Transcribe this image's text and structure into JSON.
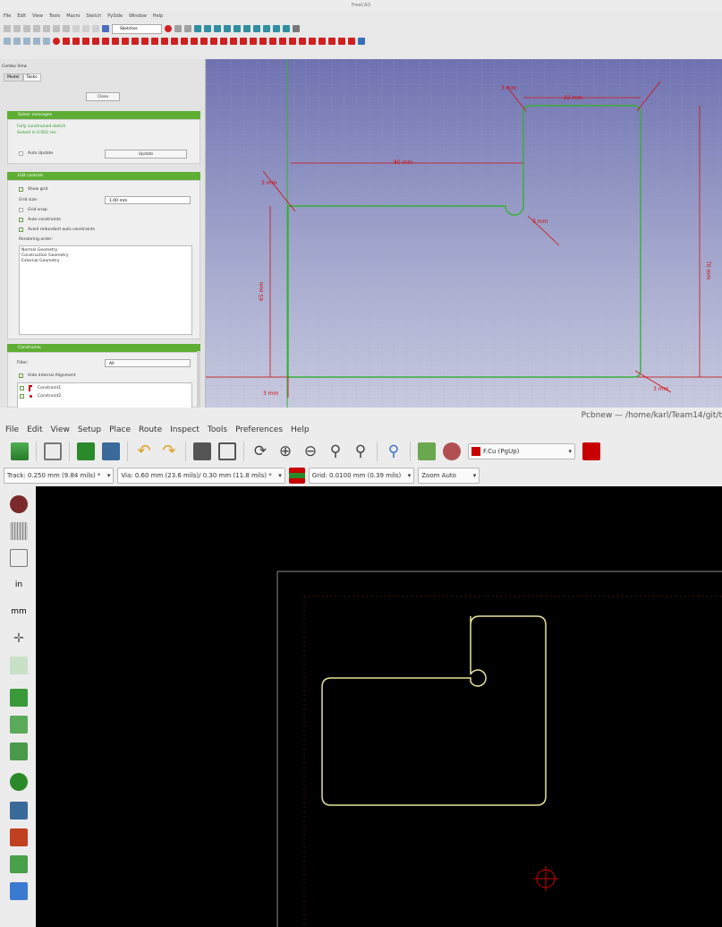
{
  "freecad": {
    "title": "FreeCAD",
    "menu": [
      "File",
      "Edit",
      "View",
      "Tools",
      "Macro",
      "Sketch",
      "PySide",
      "Window",
      "Help"
    ],
    "workbench": "Sketcher",
    "panel": {
      "title": "Combo View",
      "tabs": [
        "Model",
        "Tasks"
      ],
      "close_label": "Close",
      "solver_title": "Solver messages",
      "solver_msg": "Fully constrained sketch",
      "solver_sub": "Solved in 0.002 sec",
      "auto_update_label": "Auto Update",
      "update_label": "Update",
      "edit_controls_title": "Edit controls",
      "show_grid_label": "Show grid",
      "grid_size_label": "Grid size:",
      "grid_size_value": "1.00 mm",
      "grid_snap_label": "Grid snap",
      "auto_constraints_label": "Auto constraints",
      "avoid_redundant_label": "Avoid redundant auto constraints",
      "rendering_order_label": "Rendering order:",
      "rendering_order": [
        "Normal Geometry",
        "Construction Geometry",
        "External Geometry"
      ],
      "constraints_title": "Constraints",
      "filter_label": "Filter:",
      "filter_value": "All",
      "hide_internal_label": "Hide Internal Alignment",
      "constraints": [
        "Constraint1",
        "Constraint2"
      ]
    },
    "dims": [
      "80 mm",
      "65 mm",
      "70 mm",
      "22 mm",
      "3 mm",
      "3 mm",
      "3 mm",
      "3 mm",
      "3 mm"
    ]
  },
  "kicad": {
    "title": "Pcbnew — /home/karl/Team14/git/t",
    "menu": [
      "File",
      "Edit",
      "View",
      "Setup",
      "Place",
      "Route",
      "Inspect",
      "Tools",
      "Preferences",
      "Help"
    ],
    "layer_select": "F.Cu (PgUp)",
    "track": "Track: 0.250 mm (9.84 mils) *",
    "via": "Via: 0.60 mm (23.6 mils)/ 0.30 mm (11.8 mils) *",
    "grid": "Grid: 0.0100 mm (0.39 mils)",
    "zoom": "Zoom Auto",
    "left_tools": [
      "drc-icon",
      "grid-icon",
      "polar-icon",
      "inch-label",
      "mm-label",
      "cursor-icon",
      "ratsnest-icon",
      "zone-icon",
      "track-icon",
      "via-icon",
      "module-icon",
      "hidden-icon",
      "pad-icon",
      "layers-icon"
    ],
    "left_inch": "in",
    "left_mm": "mm"
  },
  "colors": {
    "pcb_outline": "#e8e29a",
    "red": "#c80000",
    "green_section": "#5fae34"
  }
}
